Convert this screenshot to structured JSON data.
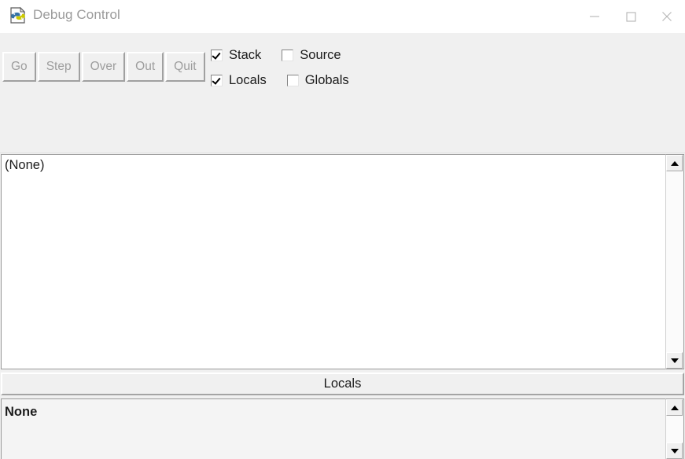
{
  "window": {
    "title": "Debug Control",
    "icon": "python-debug-icon",
    "controls": [
      {
        "name": "minimize-button",
        "glyph": "minimize-icon"
      },
      {
        "name": "maximize-button",
        "glyph": "maximize-icon"
      },
      {
        "name": "close-button",
        "glyph": "close-icon"
      }
    ]
  },
  "toolbar": {
    "buttons": [
      {
        "label": "Go",
        "name": "go-button",
        "disabled": true
      },
      {
        "label": "Step",
        "name": "step-button",
        "disabled": true
      },
      {
        "label": "Over",
        "name": "over-button",
        "disabled": true
      },
      {
        "label": "Out",
        "name": "out-button",
        "disabled": true
      },
      {
        "label": "Quit",
        "name": "quit-button",
        "disabled": true
      }
    ],
    "checkboxes": [
      {
        "label": "Stack",
        "name": "checkbox-stack",
        "checked": true
      },
      {
        "label": "Source",
        "name": "checkbox-source",
        "checked": false
      },
      {
        "label": "Locals",
        "name": "checkbox-locals",
        "checked": true
      },
      {
        "label": "Globals",
        "name": "checkbox-globals",
        "checked": false
      }
    ]
  },
  "stack_viewer": {
    "entry": "(None)",
    "scrollbar": {
      "up_arrow": "scroll-up-icon",
      "down_arrow": "scroll-down-icon"
    }
  },
  "locals_section": {
    "header": "Locals",
    "entry": "None",
    "scrollbar": {
      "up_arrow": "scroll-up-icon",
      "down_arrow": "scroll-down-icon"
    }
  },
  "colors": {
    "window_background": "#f0f0f0",
    "titlebar_background": "#ffffff",
    "title_text": "#9a9a9a",
    "listbox_background": "#ffffff",
    "locals_background": "#f4f4f4",
    "disabled_button_text": "#9d9d9d",
    "body_text": "#1b1b1b"
  }
}
